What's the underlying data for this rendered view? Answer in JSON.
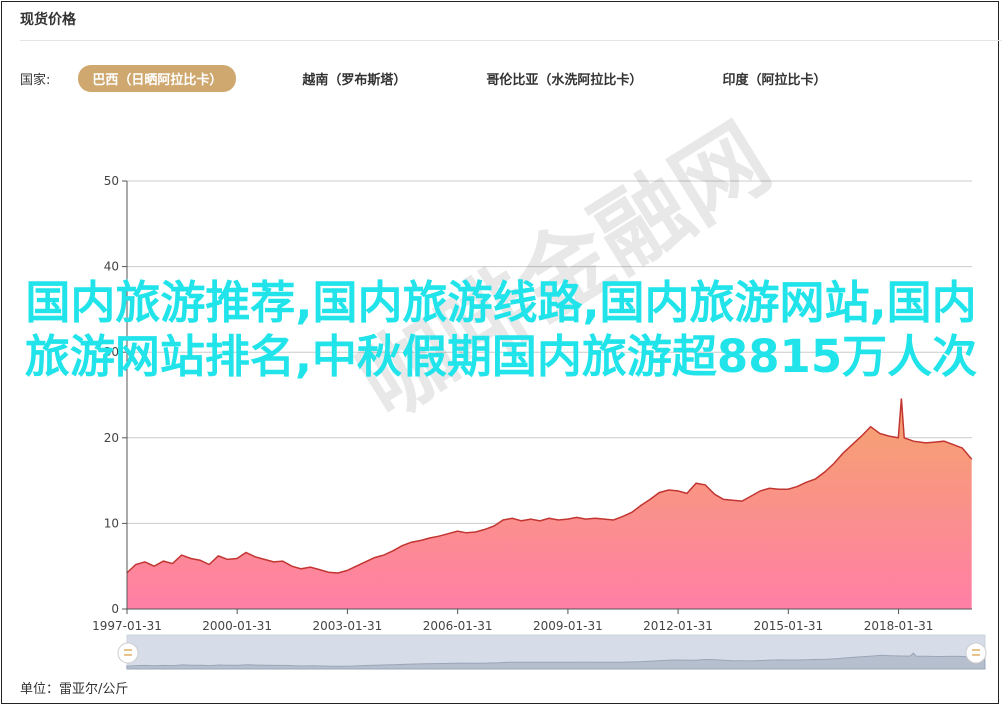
{
  "header": {
    "title": "现货价格"
  },
  "filters": {
    "label": "国家:",
    "options": [
      {
        "label": "巴西（日晒阿拉比卡）",
        "active": true
      },
      {
        "label": "越南（罗布斯塔）",
        "active": false
      },
      {
        "label": "哥伦比亚（水洗阿拉比卡）",
        "active": false
      },
      {
        "label": "印度（阿拉比卡）",
        "active": false
      }
    ]
  },
  "footer": {
    "unit": "单位：雷亚尔/公斤"
  },
  "overlay": {
    "headline": "国内旅游推荐,国内旅游线路,国内旅游网站,国内旅游网站排名,中秋假期国内旅游超8815万人次",
    "watermark": "咖啡金融网"
  },
  "colors": {
    "line": "#c23531",
    "area_top": "#f5a46c",
    "area_bottom": "#ff7fa6",
    "chip_active": "#cfa870"
  },
  "chart_data": {
    "type": "area",
    "ylim": [
      0,
      50
    ],
    "yticks": [
      0,
      10,
      20,
      30,
      40,
      50
    ],
    "xticks": [
      "1997-01-31",
      "2000-01-31",
      "2003-01-31",
      "2006-01-31",
      "2009-01-31",
      "2012-01-31",
      "2015-01-31",
      "2018-01-31"
    ],
    "x_range": [
      "1997-01-31",
      "2020-01-31"
    ],
    "grid": true,
    "has_zoom_slider": true,
    "series": [
      {
        "points": [
          [
            "1997-01",
            4.2
          ],
          [
            "1997-04",
            5.2
          ],
          [
            "1997-07",
            5.5
          ],
          [
            "1997-10",
            5.0
          ],
          [
            "1998-01",
            5.6
          ],
          [
            "1998-04",
            5.3
          ],
          [
            "1998-07",
            6.3
          ],
          [
            "1998-10",
            5.9
          ],
          [
            "1999-01",
            5.7
          ],
          [
            "1999-04",
            5.2
          ],
          [
            "1999-07",
            6.2
          ],
          [
            "1999-10",
            5.8
          ],
          [
            "2000-01",
            5.9
          ],
          [
            "2000-04",
            6.6
          ],
          [
            "2000-07",
            6.1
          ],
          [
            "2000-10",
            5.8
          ],
          [
            "2001-01",
            5.5
          ],
          [
            "2001-04",
            5.6
          ],
          [
            "2001-07",
            5.0
          ],
          [
            "2001-10",
            4.7
          ],
          [
            "2002-01",
            4.9
          ],
          [
            "2002-04",
            4.6
          ],
          [
            "2002-07",
            4.3
          ],
          [
            "2002-10",
            4.2
          ],
          [
            "2003-01",
            4.5
          ],
          [
            "2003-04",
            5.0
          ],
          [
            "2003-07",
            5.5
          ],
          [
            "2003-10",
            6.0
          ],
          [
            "2004-01",
            6.3
          ],
          [
            "2004-04",
            6.8
          ],
          [
            "2004-07",
            7.4
          ],
          [
            "2004-10",
            7.8
          ],
          [
            "2005-01",
            8.0
          ],
          [
            "2005-04",
            8.3
          ],
          [
            "2005-07",
            8.5
          ],
          [
            "2005-10",
            8.8
          ],
          [
            "2006-01",
            9.1
          ],
          [
            "2006-04",
            8.9
          ],
          [
            "2006-07",
            9.0
          ],
          [
            "2006-10",
            9.3
          ],
          [
            "2007-01",
            9.7
          ],
          [
            "2007-04",
            10.4
          ],
          [
            "2007-07",
            10.6
          ],
          [
            "2007-10",
            10.3
          ],
          [
            "2008-01",
            10.5
          ],
          [
            "2008-04",
            10.3
          ],
          [
            "2008-07",
            10.6
          ],
          [
            "2008-10",
            10.4
          ],
          [
            "2009-01",
            10.5
          ],
          [
            "2009-04",
            10.7
          ],
          [
            "2009-07",
            10.5
          ],
          [
            "2009-10",
            10.6
          ],
          [
            "2010-01",
            10.5
          ],
          [
            "2010-04",
            10.4
          ],
          [
            "2010-07",
            10.8
          ],
          [
            "2010-10",
            11.3
          ],
          [
            "2011-01",
            12.1
          ],
          [
            "2011-04",
            12.8
          ],
          [
            "2011-07",
            13.6
          ],
          [
            "2011-10",
            13.9
          ],
          [
            "2012-01",
            13.8
          ],
          [
            "2012-04",
            13.5
          ],
          [
            "2012-07",
            14.7
          ],
          [
            "2012-10",
            14.5
          ],
          [
            "2013-01",
            13.4
          ],
          [
            "2013-04",
            12.8
          ],
          [
            "2013-07",
            12.7
          ],
          [
            "2013-10",
            12.6
          ],
          [
            "2014-01",
            13.2
          ],
          [
            "2014-04",
            13.8
          ],
          [
            "2014-07",
            14.1
          ],
          [
            "2014-10",
            14.0
          ],
          [
            "2015-01",
            14.0
          ],
          [
            "2015-04",
            14.3
          ],
          [
            "2015-07",
            14.8
          ],
          [
            "2015-10",
            15.2
          ],
          [
            "2016-01",
            16.0
          ],
          [
            "2016-04",
            17.0
          ],
          [
            "2016-07",
            18.2
          ],
          [
            "2016-10",
            19.2
          ],
          [
            "2017-01",
            20.2
          ],
          [
            "2017-04",
            21.3
          ],
          [
            "2017-07",
            20.5
          ],
          [
            "2017-10",
            20.2
          ],
          [
            "2018-01",
            20.0
          ],
          [
            "2018-02",
            24.6
          ],
          [
            "2018-03",
            20.0
          ],
          [
            "2018-06",
            19.6
          ],
          [
            "2018-10",
            19.4
          ],
          [
            "2019-01",
            19.5
          ],
          [
            "2019-04",
            19.6
          ],
          [
            "2019-07",
            19.2
          ],
          [
            "2019-10",
            18.8
          ],
          [
            "2020-01",
            17.5
          ]
        ]
      }
    ]
  }
}
